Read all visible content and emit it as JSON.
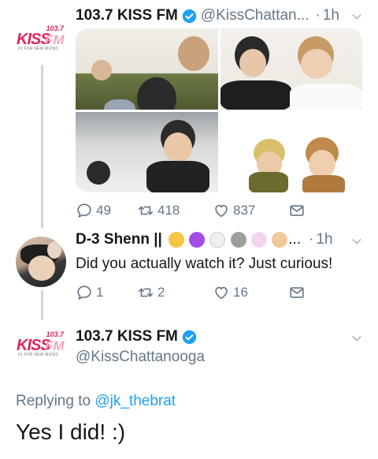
{
  "tweet1": {
    "name": "103.7 KISS FM",
    "handle": "@KissChattan...",
    "separator": "·",
    "time": "1h",
    "counts": {
      "replies": "49",
      "retweets": "418",
      "likes": "837"
    }
  },
  "tweet2": {
    "name": "D-3 Shenn ||",
    "emoji_overflow": "...",
    "separator": "·",
    "time": "1h",
    "text": "Did you actually watch it? Just curious!",
    "counts": {
      "replies": "1",
      "retweets": "2",
      "likes": "16"
    }
  },
  "tweet3": {
    "name": "103.7 KISS FM",
    "handle": "@KissChattanooga",
    "replying_prefix": "Replying to",
    "replying_to": "@jk_thebrat",
    "text": "Yes I did! :)"
  },
  "logo": {
    "number": "103.7",
    "word": "KISS",
    "suffix": "FM",
    "tagline": "#1 FOR NEW MUSIC"
  },
  "icons": {
    "verified": "verified-badge-icon",
    "reply": "reply-icon",
    "retweet": "retweet-icon",
    "like": "heart-icon",
    "dm": "direct-message-icon",
    "more": "chevron-down-icon"
  },
  "colors": {
    "accent": "#1da1f2",
    "muted": "#657786",
    "text": "#14171a",
    "brand": "#e0245e",
    "line": "#ccd6dd"
  }
}
